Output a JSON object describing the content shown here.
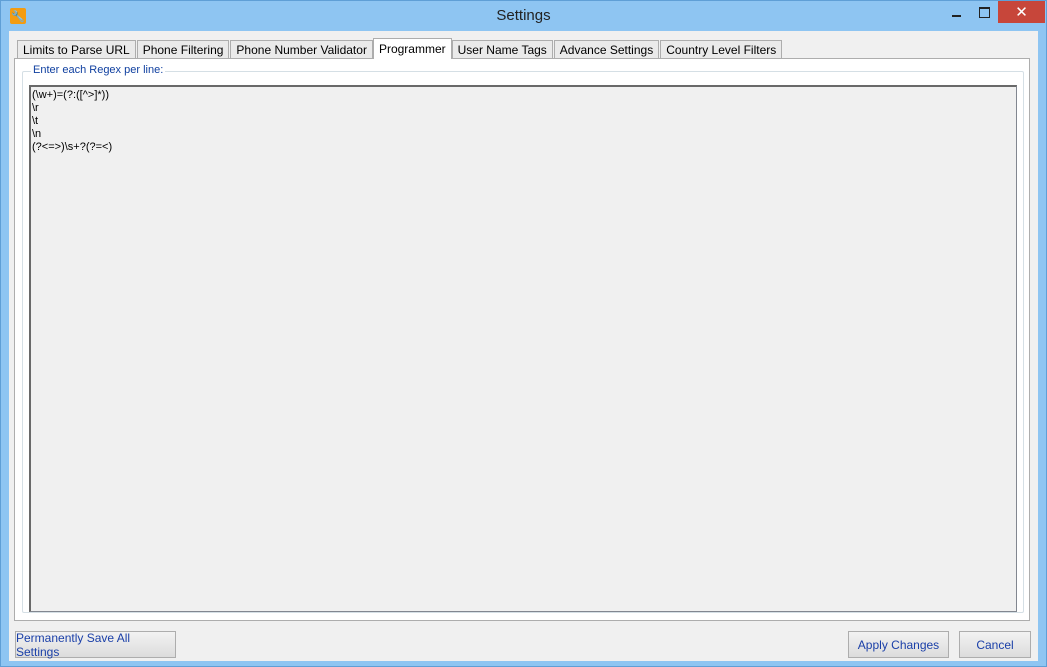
{
  "window": {
    "title": "Settings",
    "icon": "wrench-icon",
    "controls": {
      "minimize": "minimize-icon",
      "maximize": "maximize-icon",
      "close": "✕"
    }
  },
  "tabs": [
    {
      "label": "Limits to Parse URL",
      "active": false
    },
    {
      "label": "Phone Filtering",
      "active": false
    },
    {
      "label": "Phone Number Validator",
      "active": false
    },
    {
      "label": "Programmer",
      "active": true
    },
    {
      "label": "User Name Tags",
      "active": false
    },
    {
      "label": "Advance Settings",
      "active": false
    },
    {
      "label": "Country Level Filters",
      "active": false
    }
  ],
  "programmer": {
    "group_label": "Enter each Regex per line:",
    "regex_text": "(\\w+)=(?:([^>]*))\n\\r\n\\t\n\\n\n(?<=>)\\s+?(?=<)"
  },
  "footer": {
    "save_label": "Permanently Save All Settings",
    "apply_label": "Apply Changes",
    "cancel_label": "Cancel"
  },
  "colors": {
    "frame": "#8ec5f2",
    "close_button": "#c7463a",
    "accent_text": "#1a3fa8"
  }
}
